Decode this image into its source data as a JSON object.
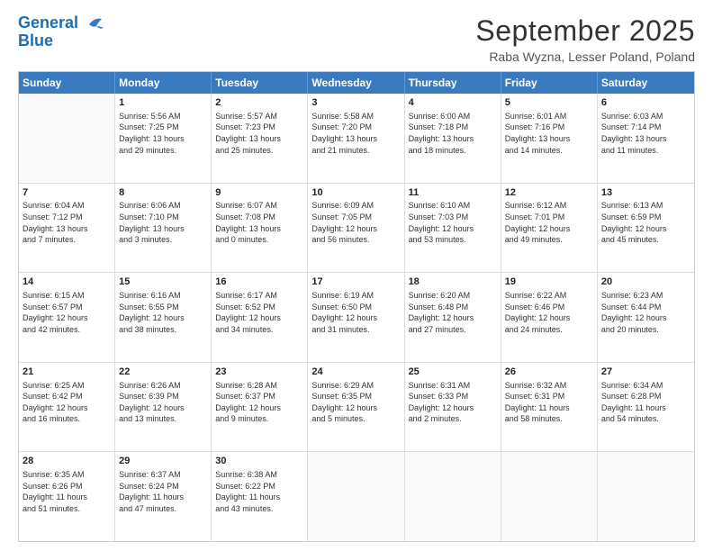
{
  "header": {
    "logo_line1": "General",
    "logo_line2": "Blue",
    "month": "September 2025",
    "location": "Raba Wyzna, Lesser Poland, Poland"
  },
  "days_of_week": [
    "Sunday",
    "Monday",
    "Tuesday",
    "Wednesday",
    "Thursday",
    "Friday",
    "Saturday"
  ],
  "weeks": [
    [
      {
        "day": "",
        "info": ""
      },
      {
        "day": "1",
        "info": "Sunrise: 5:56 AM\nSunset: 7:25 PM\nDaylight: 13 hours\nand 29 minutes."
      },
      {
        "day": "2",
        "info": "Sunrise: 5:57 AM\nSunset: 7:23 PM\nDaylight: 13 hours\nand 25 minutes."
      },
      {
        "day": "3",
        "info": "Sunrise: 5:58 AM\nSunset: 7:20 PM\nDaylight: 13 hours\nand 21 minutes."
      },
      {
        "day": "4",
        "info": "Sunrise: 6:00 AM\nSunset: 7:18 PM\nDaylight: 13 hours\nand 18 minutes."
      },
      {
        "day": "5",
        "info": "Sunrise: 6:01 AM\nSunset: 7:16 PM\nDaylight: 13 hours\nand 14 minutes."
      },
      {
        "day": "6",
        "info": "Sunrise: 6:03 AM\nSunset: 7:14 PM\nDaylight: 13 hours\nand 11 minutes."
      }
    ],
    [
      {
        "day": "7",
        "info": "Sunrise: 6:04 AM\nSunset: 7:12 PM\nDaylight: 13 hours\nand 7 minutes."
      },
      {
        "day": "8",
        "info": "Sunrise: 6:06 AM\nSunset: 7:10 PM\nDaylight: 13 hours\nand 3 minutes."
      },
      {
        "day": "9",
        "info": "Sunrise: 6:07 AM\nSunset: 7:08 PM\nDaylight: 13 hours\nand 0 minutes."
      },
      {
        "day": "10",
        "info": "Sunrise: 6:09 AM\nSunset: 7:05 PM\nDaylight: 12 hours\nand 56 minutes."
      },
      {
        "day": "11",
        "info": "Sunrise: 6:10 AM\nSunset: 7:03 PM\nDaylight: 12 hours\nand 53 minutes."
      },
      {
        "day": "12",
        "info": "Sunrise: 6:12 AM\nSunset: 7:01 PM\nDaylight: 12 hours\nand 49 minutes."
      },
      {
        "day": "13",
        "info": "Sunrise: 6:13 AM\nSunset: 6:59 PM\nDaylight: 12 hours\nand 45 minutes."
      }
    ],
    [
      {
        "day": "14",
        "info": "Sunrise: 6:15 AM\nSunset: 6:57 PM\nDaylight: 12 hours\nand 42 minutes."
      },
      {
        "day": "15",
        "info": "Sunrise: 6:16 AM\nSunset: 6:55 PM\nDaylight: 12 hours\nand 38 minutes."
      },
      {
        "day": "16",
        "info": "Sunrise: 6:17 AM\nSunset: 6:52 PM\nDaylight: 12 hours\nand 34 minutes."
      },
      {
        "day": "17",
        "info": "Sunrise: 6:19 AM\nSunset: 6:50 PM\nDaylight: 12 hours\nand 31 minutes."
      },
      {
        "day": "18",
        "info": "Sunrise: 6:20 AM\nSunset: 6:48 PM\nDaylight: 12 hours\nand 27 minutes."
      },
      {
        "day": "19",
        "info": "Sunrise: 6:22 AM\nSunset: 6:46 PM\nDaylight: 12 hours\nand 24 minutes."
      },
      {
        "day": "20",
        "info": "Sunrise: 6:23 AM\nSunset: 6:44 PM\nDaylight: 12 hours\nand 20 minutes."
      }
    ],
    [
      {
        "day": "21",
        "info": "Sunrise: 6:25 AM\nSunset: 6:42 PM\nDaylight: 12 hours\nand 16 minutes."
      },
      {
        "day": "22",
        "info": "Sunrise: 6:26 AM\nSunset: 6:39 PM\nDaylight: 12 hours\nand 13 minutes."
      },
      {
        "day": "23",
        "info": "Sunrise: 6:28 AM\nSunset: 6:37 PM\nDaylight: 12 hours\nand 9 minutes."
      },
      {
        "day": "24",
        "info": "Sunrise: 6:29 AM\nSunset: 6:35 PM\nDaylight: 12 hours\nand 5 minutes."
      },
      {
        "day": "25",
        "info": "Sunrise: 6:31 AM\nSunset: 6:33 PM\nDaylight: 12 hours\nand 2 minutes."
      },
      {
        "day": "26",
        "info": "Sunrise: 6:32 AM\nSunset: 6:31 PM\nDaylight: 11 hours\nand 58 minutes."
      },
      {
        "day": "27",
        "info": "Sunrise: 6:34 AM\nSunset: 6:28 PM\nDaylight: 11 hours\nand 54 minutes."
      }
    ],
    [
      {
        "day": "28",
        "info": "Sunrise: 6:35 AM\nSunset: 6:26 PM\nDaylight: 11 hours\nand 51 minutes."
      },
      {
        "day": "29",
        "info": "Sunrise: 6:37 AM\nSunset: 6:24 PM\nDaylight: 11 hours\nand 47 minutes."
      },
      {
        "day": "30",
        "info": "Sunrise: 6:38 AM\nSunset: 6:22 PM\nDaylight: 11 hours\nand 43 minutes."
      },
      {
        "day": "",
        "info": ""
      },
      {
        "day": "",
        "info": ""
      },
      {
        "day": "",
        "info": ""
      },
      {
        "day": "",
        "info": ""
      }
    ]
  ]
}
